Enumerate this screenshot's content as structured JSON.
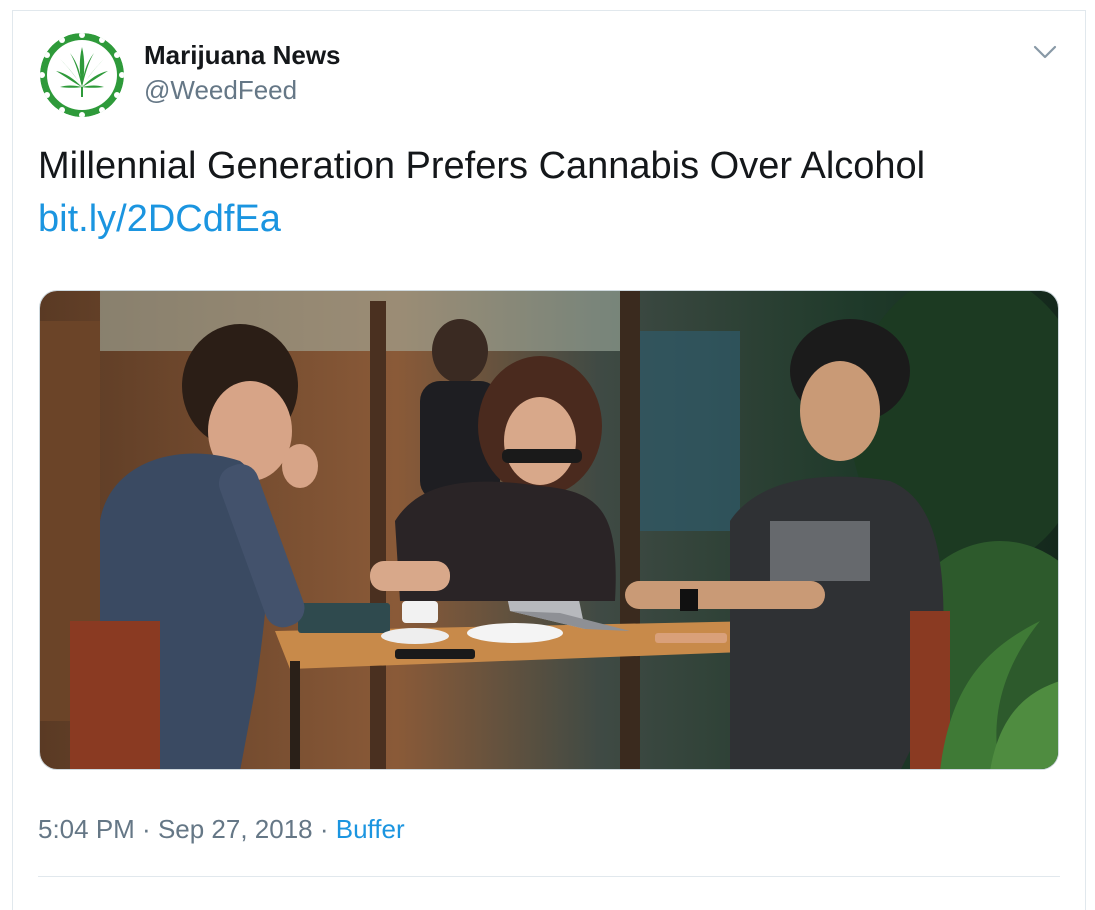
{
  "tweet": {
    "author_name": "Marijuana News",
    "author_handle": "@WeedFeed",
    "text": "Millennial Generation Prefers Cannabis Over Alcohol",
    "link_text": "bit.ly/2DCdfEa",
    "time": "5:04 PM",
    "date": "Sep 27, 2018",
    "source": "Buffer",
    "separator": " · "
  },
  "icons": {
    "avatar": "cannabis-leaf-logo",
    "menu": "chevron-down-icon"
  },
  "colors": {
    "text_primary": "#14171a",
    "text_secondary": "#657786",
    "link": "#1b95e0",
    "avatar_green": "#2e9a3a",
    "border": "#e1e8ed"
  }
}
